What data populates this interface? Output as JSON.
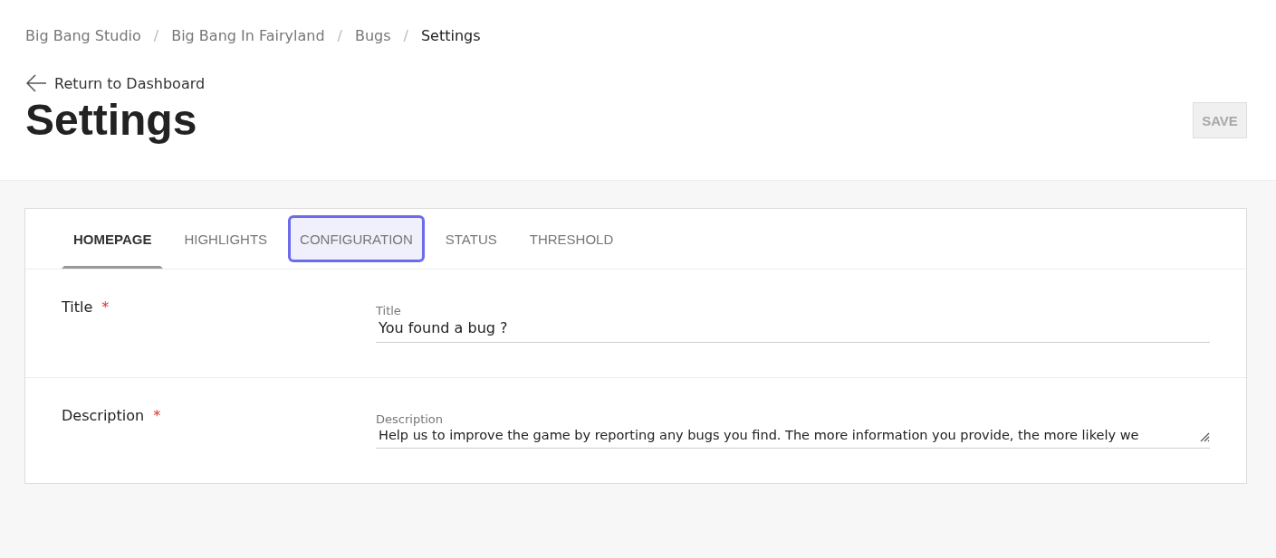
{
  "breadcrumb": [
    {
      "label": "Big Bang Studio",
      "current": false
    },
    {
      "label": "Big Bang In Fairyland",
      "current": false
    },
    {
      "label": "Bugs",
      "current": false
    },
    {
      "label": "Settings",
      "current": true
    }
  ],
  "separator": "/",
  "back_link": "Return to Dashboard",
  "page_title": "Settings",
  "save_button": {
    "label": "SAVE",
    "disabled": true
  },
  "tabs": [
    {
      "label": "HOMEPAGE",
      "selected": true,
      "focused": false
    },
    {
      "label": "HIGHLIGHTS",
      "selected": false,
      "focused": false
    },
    {
      "label": "CONFIGURATION",
      "selected": false,
      "focused": true
    },
    {
      "label": "STATUS",
      "selected": false,
      "focused": false
    },
    {
      "label": "THRESHOLD",
      "selected": false,
      "focused": false
    }
  ],
  "fields": [
    {
      "kind": "input",
      "label": "Title",
      "required_mark": "*",
      "field_label": "Title",
      "value": "You found a bug ?"
    },
    {
      "kind": "textarea",
      "label": "Description",
      "required_mark": "*",
      "field_label": "Description",
      "value": "Help us to improve the game by reporting any bugs you find. The more information you provide, the more likely we"
    }
  ]
}
